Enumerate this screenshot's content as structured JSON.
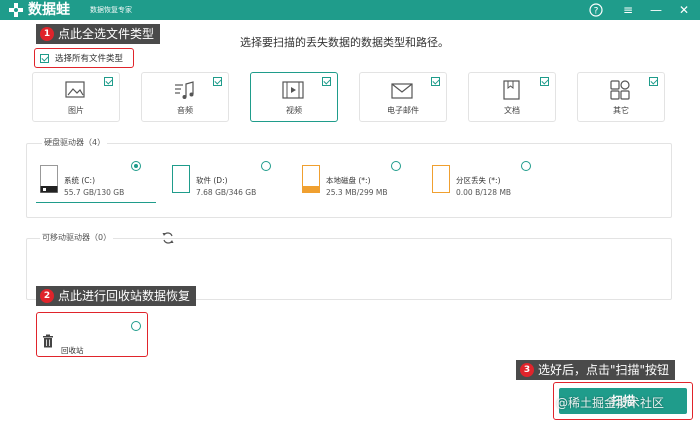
{
  "titlebar": {
    "app_name": "数据蛙",
    "app_sub": "数据恢复专家",
    "help": "?",
    "menu": "≡",
    "minimize": "—",
    "close": "✕"
  },
  "heading": "选择要扫描的丢失数据的数据类型和路径。",
  "callouts": [
    {
      "num": "1",
      "text": "点此全选文件类型"
    },
    {
      "num": "2",
      "text": "点此进行回收站数据恢复"
    },
    {
      "num": "3",
      "text": "选好后，点击\"扫描\"按钮"
    }
  ],
  "select_all": {
    "label": "选择所有文件类型",
    "checked": true
  },
  "file_types": [
    {
      "label": "图片",
      "icon": "image-icon",
      "checked": true
    },
    {
      "label": "音频",
      "icon": "audio-icon",
      "checked": true
    },
    {
      "label": "视频",
      "icon": "video-icon",
      "checked": true
    },
    {
      "label": "电子邮件",
      "icon": "email-icon",
      "checked": true
    },
    {
      "label": "文档",
      "icon": "document-icon",
      "checked": true
    },
    {
      "label": "其它",
      "icon": "other-icon",
      "checked": true
    }
  ],
  "hard_drives": {
    "title": "硬盘驱动器（4）",
    "items": [
      {
        "name": "系统 (C:)",
        "size": "55.7 GB/130 GB",
        "selected": true
      },
      {
        "name": "软件 (D:)",
        "size": "7.68 GB/346 GB",
        "selected": false
      },
      {
        "name": "本地磁盘 (*:)",
        "size": "25.3 MB/299 MB",
        "selected": false
      },
      {
        "name": "分区丢失 (*:)",
        "size": "0.00  B/128 MB",
        "selected": false
      }
    ]
  },
  "removable": {
    "title": "可移动驱动器（0）"
  },
  "recycle": {
    "label": "回收站"
  },
  "scan_button": {
    "label": "扫描"
  },
  "watermark": "@稀土掘金技术社区",
  "colors": {
    "accent": "#1f9c8b",
    "callout_bg": "#4a4a4a",
    "highlight": "#e0242b"
  }
}
